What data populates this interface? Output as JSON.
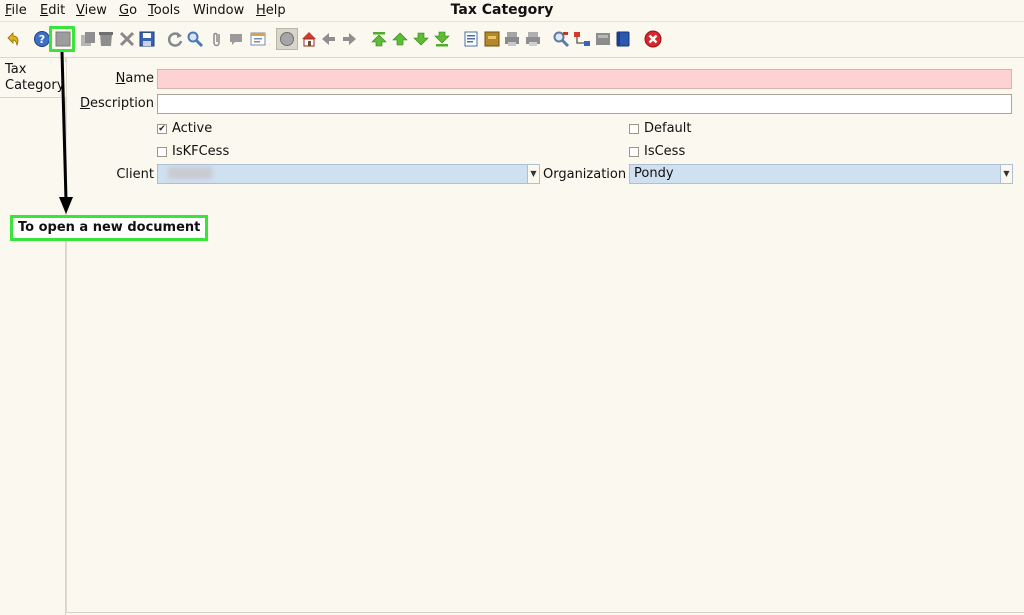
{
  "menu": {
    "items": [
      {
        "label": "File",
        "u": "F",
        "rest": "ile"
      },
      {
        "label": "Edit",
        "u": "E",
        "rest": "dit"
      },
      {
        "label": "View",
        "u": "V",
        "rest": "iew"
      },
      {
        "label": "Go",
        "u": "G",
        "rest": "o"
      },
      {
        "label": "Tools",
        "u": "T",
        "rest": "ools"
      },
      {
        "label": "Window",
        "u": "",
        "rest": "Window"
      },
      {
        "label": "Help",
        "u": "H",
        "rest": "elp"
      }
    ]
  },
  "window": {
    "title": "Tax Category"
  },
  "tabs": {
    "tax_category": "Tax Category"
  },
  "form": {
    "name_label_u": "N",
    "name_label_rest": "ame",
    "name_value": "",
    "description_label_u": "D",
    "description_label_rest": "escription",
    "description_value": "",
    "active_label": "Active",
    "active_checked": true,
    "default_label": "Default",
    "default_checked": false,
    "iskfcess_label": "IsKFCess",
    "iskfcess_checked": false,
    "iscess_label": "IsCess",
    "iscess_checked": false,
    "client_label": "Client",
    "client_value": "",
    "organization_label": "Organization",
    "organization_value": "Pondy"
  },
  "annotation": {
    "text": "To open a new document"
  },
  "colors": {
    "highlight": "#39e53a",
    "required_field": "#ffd2d2",
    "select_bg": "#cfe0f1"
  }
}
